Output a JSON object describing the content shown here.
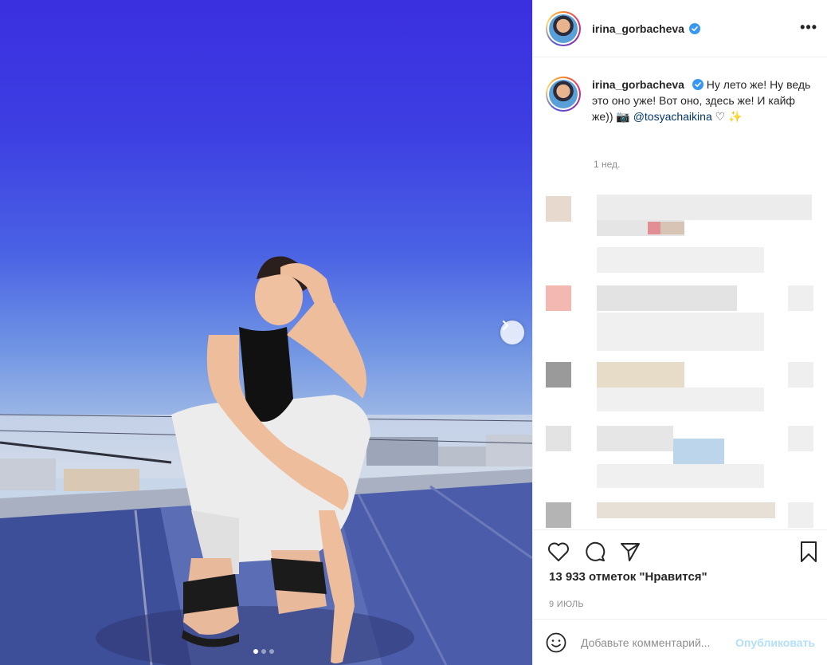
{
  "post": {
    "username": "irina_gorbacheva",
    "caption_text": "Ну лето же! Ну ведь это оно уже! Вот оно, здесь же! И кайф же)) 📷 ",
    "mention": "@tosyachaikina",
    "caption_tail": " ♡ ✨",
    "time_ago": "1 нед.",
    "likes": "13 933 отметок \"Нравится\"",
    "date": "9 ИЮЛЬ",
    "more": "•••"
  },
  "carousel": {
    "total": 3,
    "active": 0
  },
  "comment": {
    "placeholder": "Добавьте комментарий...",
    "publish_label": "Опубликовать"
  },
  "colors": {
    "brand_link": "#00376b",
    "verified": "#3897f0",
    "publish_disabled": "#b2dffc"
  },
  "icons": [
    "heart-icon",
    "comment-icon",
    "share-icon",
    "bookmark-icon",
    "emoji-icon",
    "verified-icon",
    "chevron-right-icon",
    "more-icon"
  ]
}
